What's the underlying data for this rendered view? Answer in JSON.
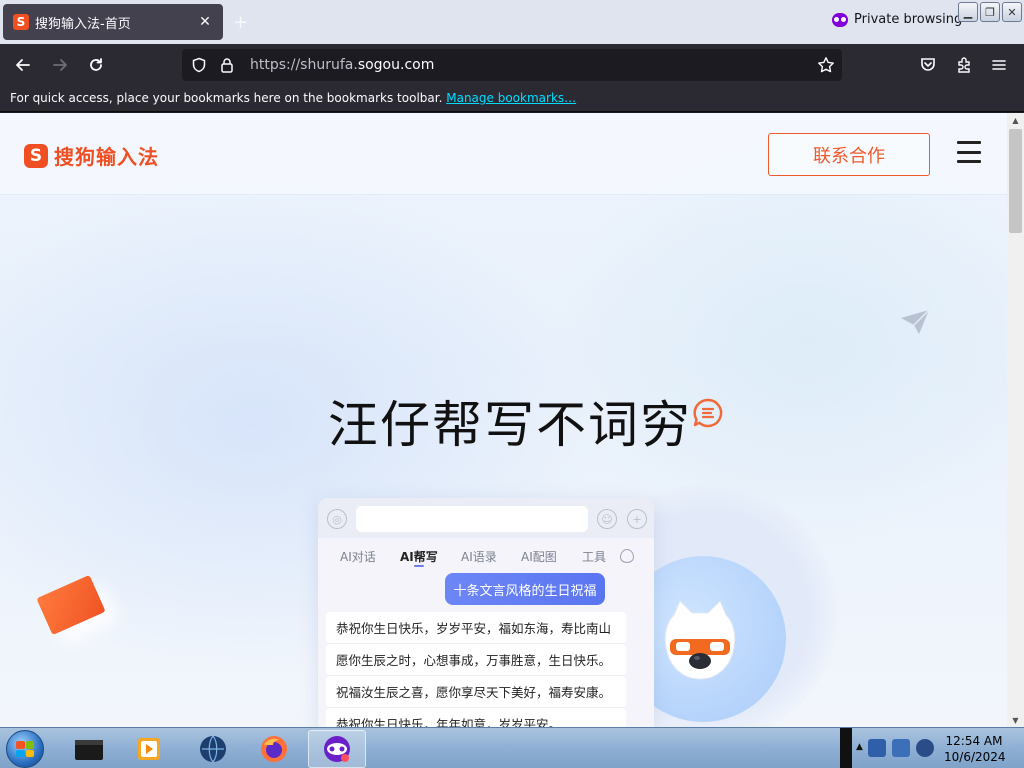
{
  "browser": {
    "tab_title": "搜狗输入法-首页",
    "tab_favicon_letter": "S",
    "new_tab_symbol": "+",
    "private_label": "Private browsing",
    "url_host": "https://shurufa.",
    "url_domain": "sogou.com",
    "bookmarks_message": "For quick access, place your bookmarks here on the bookmarks toolbar.",
    "manage_bookmarks_label": "Manage bookmarks…",
    "window_buttons": [
      "minimize",
      "restore",
      "close"
    ]
  },
  "site": {
    "logo_letter": "S",
    "logo_text": "搜狗输入法",
    "contact_button": "联系合作",
    "hero_title": "汪仔帮写不词穷",
    "phone": {
      "tabs": [
        "AI对话",
        "AI帮写",
        "AI语录",
        "AI配图",
        "工具"
      ],
      "active_tab": "AI帮写",
      "prompt": "十条文言风格的生日祝福",
      "replies": [
        "恭祝你生日快乐，岁岁平安，福如东海，寿比南山",
        "愿你生辰之时，心想事成，万事胜意，生日快乐。",
        "祝福汝生辰之喜，愿你享尽天下美好，福寿安康。",
        "恭祝你生日快乐，年年如意，岁岁平安。"
      ]
    }
  },
  "taskbar": {
    "clock_time": "12:54 AM",
    "clock_date": "10/6/2024"
  },
  "colors": {
    "brand": "#f04e23",
    "accent_blue": "#5a75f1",
    "chrome_dark": "#2b2a33",
    "link": "#00ddff"
  },
  "icons": [
    "back-icon",
    "forward-icon",
    "reload-icon",
    "shield-icon",
    "lock-icon",
    "star-icon",
    "pocket-icon",
    "extensions-icon",
    "menu-icon",
    "paper-plane-icon",
    "chat-bubble-icon",
    "mascot-icon"
  ]
}
